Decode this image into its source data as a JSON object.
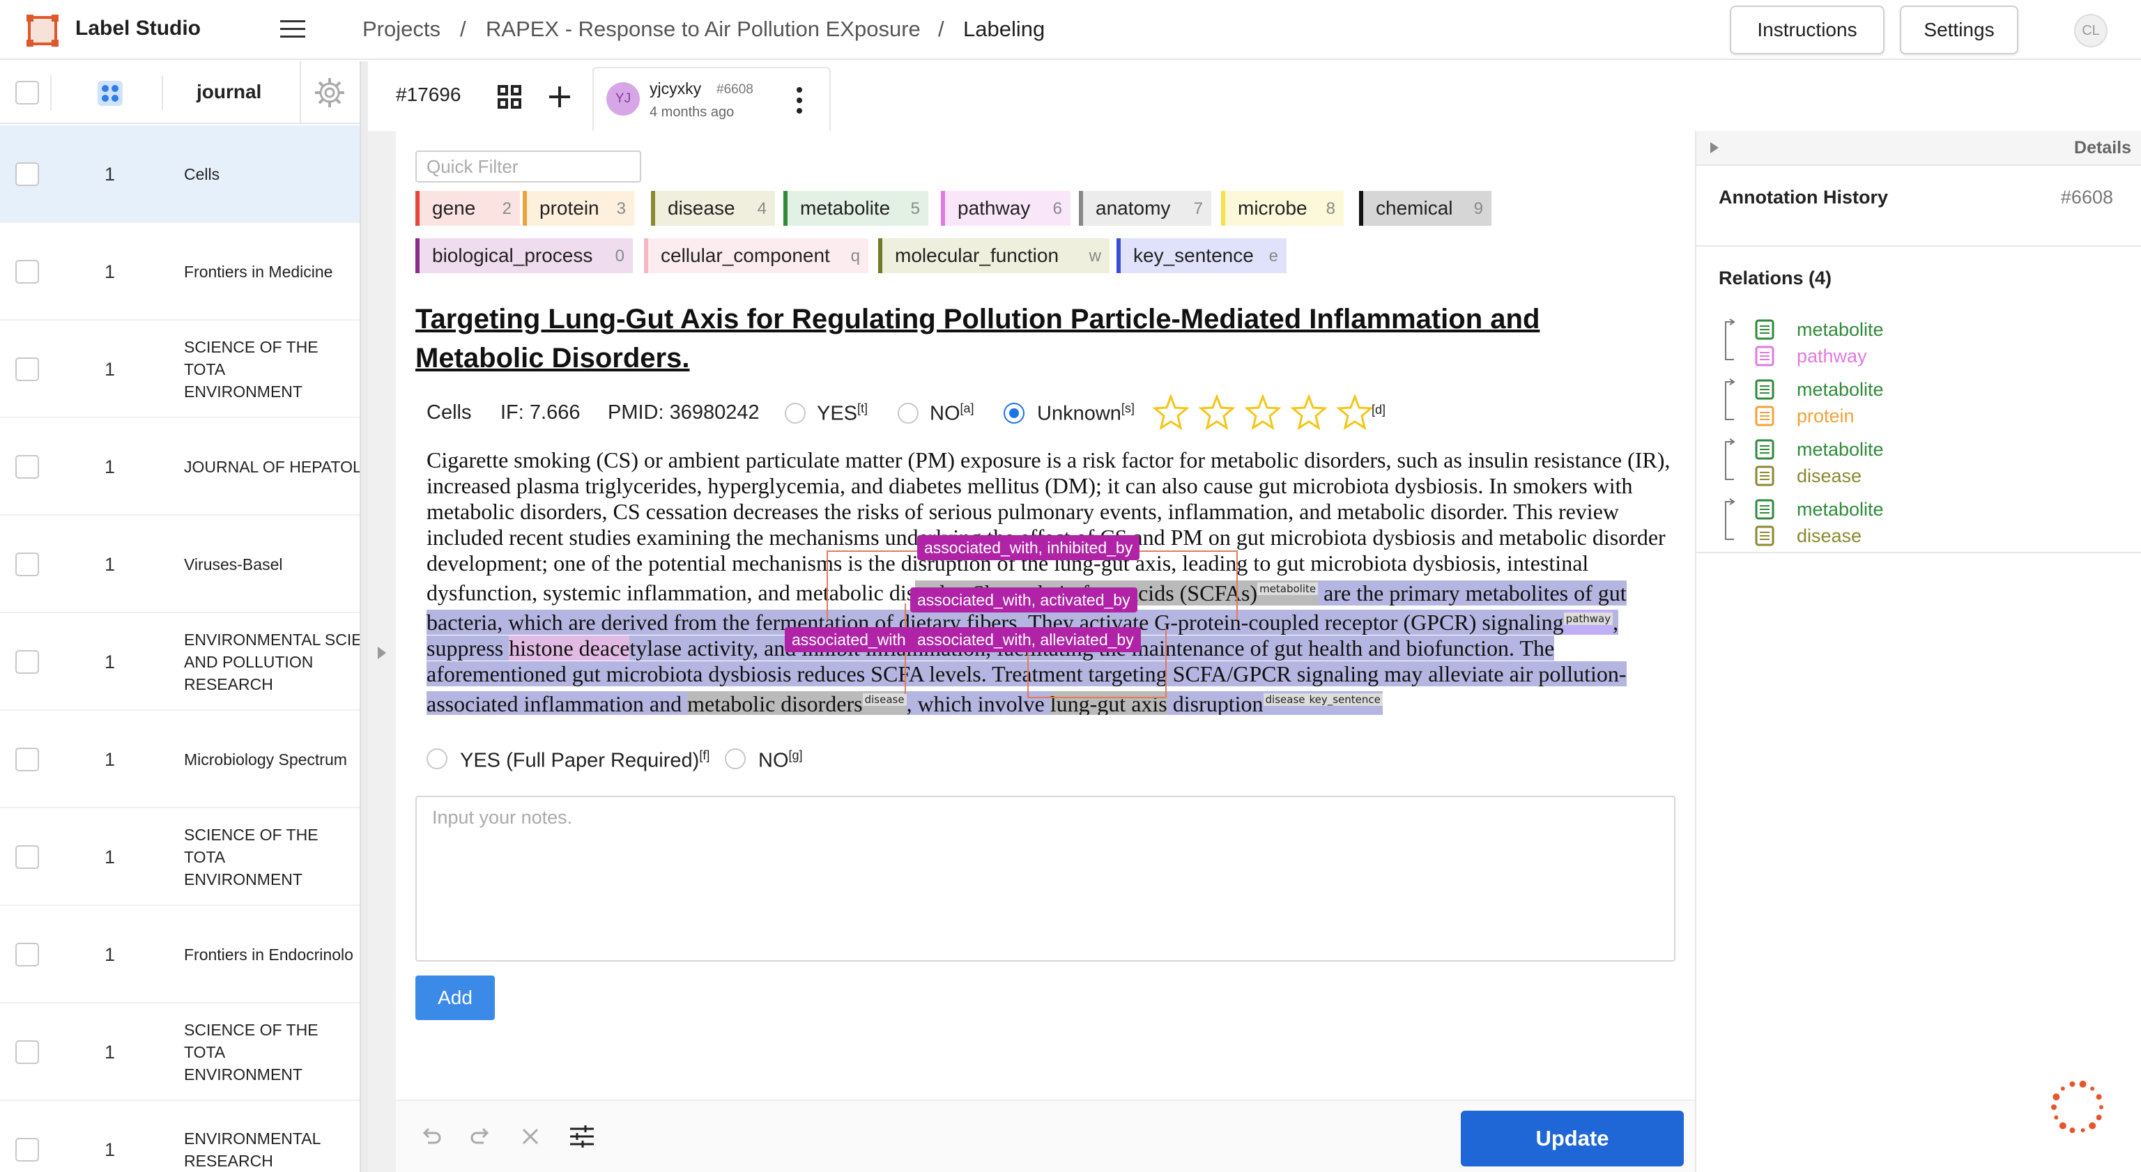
{
  "app": {
    "brand": "Label Studio",
    "accent": "#1f66d6"
  },
  "breadcrumb": [
    "Projects",
    "RAPEX - Response to Air Pollution EXposure",
    "Labeling"
  ],
  "header": {
    "instructions_label": "Instructions",
    "settings_label": "Settings",
    "user_initials": "CL"
  },
  "list": {
    "column_header": "journal",
    "rows": [
      {
        "num": "1",
        "journal": "Cells",
        "selected": true
      },
      {
        "num": "1",
        "journal": "Frontiers in Medicine"
      },
      {
        "num": "1",
        "journal": "SCIENCE OF THE TOTA\nENVIRONMENT"
      },
      {
        "num": "1",
        "journal": "JOURNAL OF HEPATOL"
      },
      {
        "num": "1",
        "journal": "Viruses-Basel"
      },
      {
        "num": "1",
        "journal": "ENVIRONMENTAL SCIE\nAND POLLUTION\nRESEARCH"
      },
      {
        "num": "1",
        "journal": "Microbiology Spectrum"
      },
      {
        "num": "1",
        "journal": "SCIENCE OF THE TOTA\nENVIRONMENT"
      },
      {
        "num": "1",
        "journal": "Frontiers in Endocrinolo"
      },
      {
        "num": "1",
        "journal": "SCIENCE OF THE TOTA\nENVIRONMENT"
      },
      {
        "num": "1",
        "journal": "ENVIRONMENTAL\nRESEARCH"
      }
    ]
  },
  "task": {
    "id": "#17696"
  },
  "annotation": {
    "user": "yjcyxky",
    "id": "#6608",
    "time": "4 months ago",
    "initials": "YJ"
  },
  "quick_filter_placeholder": "Quick Filter",
  "labels": [
    {
      "name": "gene",
      "key": "2",
      "color": "#e6463c",
      "bg": "#fbe3e1"
    },
    {
      "name": "protein",
      "key": "3",
      "color": "#f0a23a",
      "bg": "#fdf0dd"
    },
    {
      "name": "disease",
      "key": "4",
      "color": "#8a8a30",
      "bg": "#f0efde"
    },
    {
      "name": "metabolite",
      "key": "5",
      "color": "#2f8a3a",
      "bg": "#e2f1e3"
    },
    {
      "name": "pathway",
      "key": "6",
      "color": "#e07ae0",
      "bg": "#f9e6f9"
    },
    {
      "name": "anatomy",
      "key": "7",
      "color": "#888888",
      "bg": "#ececec"
    },
    {
      "name": "microbe",
      "key": "8",
      "color": "#f3e34a",
      "bg": "#fcf8d9"
    },
    {
      "name": "chemical",
      "key": "9",
      "color": "#111111",
      "bg": "#d6d6d6"
    },
    {
      "name": "biological_process",
      "key": "0",
      "color": "#8a2a8a",
      "bg": "#efdcef"
    },
    {
      "name": "cellular_component",
      "key": "q",
      "color": "#f2b9c4",
      "bg": "#fcecef"
    },
    {
      "name": "molecular_function",
      "key": "w",
      "color": "#6f7a2a",
      "bg": "#eeefdd"
    },
    {
      "name": "key_sentence",
      "key": "e",
      "color": "#3a4fd8",
      "bg": "#dfe2fa"
    }
  ],
  "paper": {
    "title": "Targeting Lung-Gut Axis for Regulating Pollution Particle-Mediated Inflammation and Metabolic Disorders.",
    "journal": "Cells",
    "impact": "IF: 7.666",
    "pmid": "PMID: 36980242"
  },
  "relevance": {
    "yes": "YES",
    "yes_key": "[t]",
    "no": "NO",
    "no_key": "[a]",
    "unknown": "Unknown",
    "unknown_key": "[s]",
    "rating_key": "[d]",
    "selected": "Unknown",
    "stars": 0
  },
  "abstract": {
    "t1": "Cigarette smoking (CS) or ambient particulate matter (PM) exposure is a risk factor for metabolic disorders, such as insulin resistance (IR), increased plasma triglycerides, hyperglycemia, and diabetes mellitus (DM); it can also cause gut microbiota dysbiosis. In smokers with metabolic disorders, CS cessation decreases the risks of serious pulmonary events, inflammation, and metabolic disorder. This review included recent studies examining the mechanisms und",
    "t1b": "erlying the effect of CS and PM on gut microbiota dysbiosis and metabolic disorder development; one of the potential m",
    "t2": "echanisms is the disruption of the lung-gut axis, leading to gut microbiota dysbiosis, intestinal dysfunction, systemic inflammation, and met",
    "t3": "abolic dis",
    "t4": "order. Short-chain fatty acids (SCFAs)",
    "tag_metabolite": "metabolite",
    "t5": " are the primary metabolites of gut bacteria, which are derived from the fermentation of dietary fibers. They activate G-protein-coupled receptor (GPCR) signaling",
    "tag_pathway": "pathway",
    "t6": ", suppress ",
    "t7": "histone deace",
    "t8": "tylase activity, and inhibit inflammation, facilitating the maintenance of gut health and biofunction. The aforementioned gut microbiota dysbiosis reduces SCFA levels. Treatment targeting SCFA/GPCR signaling may alleviate air pollution-associated inflammation and ",
    "t9": "metabolic disorders",
    "tag_disease": "disease",
    "t10": ", which involve ",
    "t11": "lung-gut axis",
    "t12": " disruption",
    "tag_disease2": "disease",
    "tag_key": "key_sentence"
  },
  "relation_tags": [
    "associated_with, inhibited_by",
    "associated_with, activated_by",
    "associated_with",
    "associated_with, alleviated_by"
  ],
  "fulltext": {
    "yes": "YES (Full Paper Required)",
    "yes_key": "[f]",
    "no": "NO",
    "no_key": "[g]"
  },
  "notes_placeholder": "Input your notes.",
  "add_label": "Add",
  "update_label": "Update",
  "details": {
    "label": "Details",
    "history_title": "Annotation History",
    "history_id": "#6608",
    "relations_title": "Relations (4)",
    "relations": [
      {
        "from": "metabolite",
        "from_color": "#2f8a3a",
        "to": "pathway",
        "to_color": "#e07ae0"
      },
      {
        "from": "metabolite",
        "from_color": "#2f8a3a",
        "to": "protein",
        "to_color": "#f0a23a"
      },
      {
        "from": "metabolite",
        "from_color": "#2f8a3a",
        "to": "disease",
        "to_color": "#8a8a30"
      },
      {
        "from": "metabolite",
        "from_color": "#2f8a3a",
        "to": "disease",
        "to_color": "#8a8a30"
      }
    ]
  }
}
